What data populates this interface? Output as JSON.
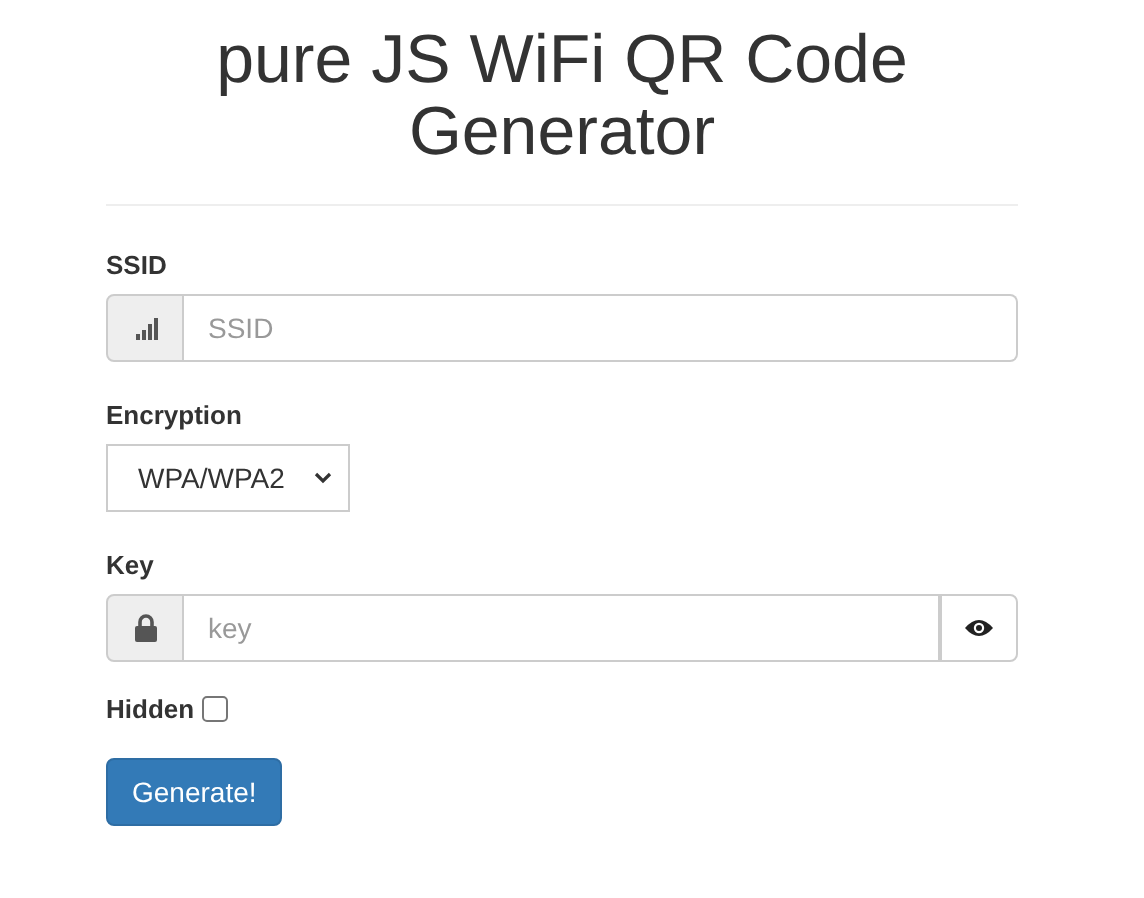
{
  "title": "pure JS WiFi QR Code Generator",
  "ssid": {
    "label": "SSID",
    "placeholder": "SSID"
  },
  "encryption": {
    "label": "Encryption",
    "value": "WPA/WPA2"
  },
  "key": {
    "label": "Key",
    "placeholder": "key"
  },
  "hidden": {
    "label": "Hidden",
    "checked": false
  },
  "button": "Generate!"
}
